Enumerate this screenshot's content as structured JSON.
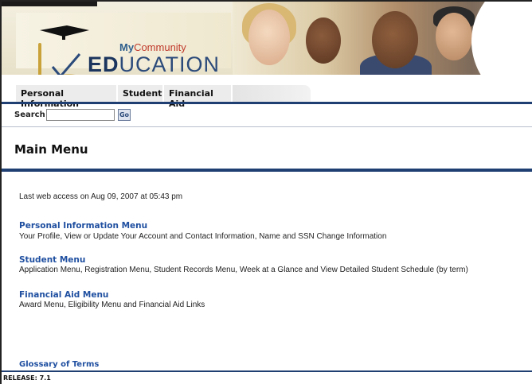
{
  "header": {
    "logo_my": "My",
    "logo_community": "Community",
    "logo_ed": "ED",
    "logo_ucation": "UCATION"
  },
  "tabs": [
    {
      "label": "Personal Information"
    },
    {
      "label": "Student"
    },
    {
      "label": "Financial Aid"
    }
  ],
  "search": {
    "label": "Search",
    "value": "",
    "go_label": "Go"
  },
  "main": {
    "title": "Main Menu",
    "last_access": "Last web access on Aug 09, 2007 at 05:43 pm",
    "menus": [
      {
        "link": "Personal Information Menu",
        "desc": "Your Profile, View or Update Your Account and Contact Information, Name and SSN Change Information"
      },
      {
        "link": "Student Menu",
        "desc": "Application Menu, Registration Menu, Student Records Menu, Week at a Glance and View Detailed Student Schedule (by term)"
      },
      {
        "link": "Financial Aid Menu",
        "desc": "Award Menu, Eligibility Menu and Financial Aid Links"
      }
    ],
    "glossary": "Glossary of Terms"
  },
  "footer": {
    "release": "RELEASE: 7.1"
  },
  "colors": {
    "accent_navy": "#1f3f73",
    "link_blue": "#1f4fa0"
  }
}
